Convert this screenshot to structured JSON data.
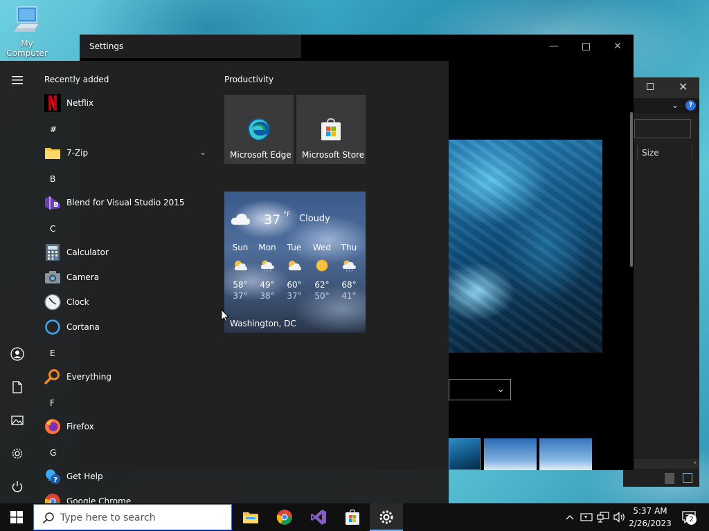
{
  "desktop": {
    "icon_label": "My Computer"
  },
  "explorer": {
    "column_size": "Size"
  },
  "settings_window": {
    "title": "Settings"
  },
  "start": {
    "recent_header": "Recently added",
    "apps": [
      {
        "name": "Netflix",
        "icon": "netflix-icon"
      },
      {
        "letter": "#"
      },
      {
        "name": "7-Zip",
        "icon": "folder-icon",
        "expandable": true
      },
      {
        "letter": "B"
      },
      {
        "name": "Blend for Visual Studio 2015",
        "icon": "blend-icon"
      },
      {
        "letter": "C"
      },
      {
        "name": "Calculator",
        "icon": "calculator-icon"
      },
      {
        "name": "Camera",
        "icon": "camera-icon"
      },
      {
        "name": "Clock",
        "icon": "clock-icon"
      },
      {
        "name": "Cortana",
        "icon": "cortana-icon"
      },
      {
        "letter": "E"
      },
      {
        "name": "Everything",
        "icon": "everything-icon"
      },
      {
        "letter": "F"
      },
      {
        "name": "Firefox",
        "icon": "firefox-icon"
      },
      {
        "letter": "G"
      },
      {
        "name": "Get Help",
        "icon": "get-help-icon"
      },
      {
        "name": "Google Chrome",
        "icon": "chrome-icon"
      }
    ],
    "tiles_group": "Productivity",
    "tiles": [
      {
        "name": "Microsoft Edge",
        "icon": "edge-icon"
      },
      {
        "name": "Microsoft Store",
        "icon": "store-icon"
      }
    ],
    "weather": {
      "temp": "37",
      "unit": "°F",
      "condition": "Cloudy",
      "location": "Washington, DC",
      "days": [
        {
          "day": "Sun",
          "hi": "58°",
          "lo": "37°",
          "icon": "partly-cloudy-icon"
        },
        {
          "day": "Mon",
          "hi": "49°",
          "lo": "38°",
          "icon": "cloudy-rain-icon"
        },
        {
          "day": "Tue",
          "hi": "60°",
          "lo": "37°",
          "icon": "partly-cloudy-icon"
        },
        {
          "day": "Wed",
          "hi": "62°",
          "lo": "50°",
          "icon": "sunny-icon"
        },
        {
          "day": "Thu",
          "hi": "68°",
          "lo": "41°",
          "icon": "cloudy-rain-icon"
        }
      ]
    }
  },
  "taskbar": {
    "search_placeholder": "Type here to search",
    "time": "5:37 AM",
    "date": "2/26/2023",
    "notification_count": "2"
  }
}
